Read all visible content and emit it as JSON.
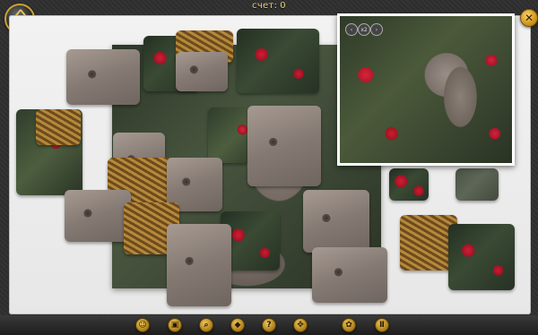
{
  "header": {
    "score_label": "счет:",
    "score_value": "0"
  },
  "preview": {
    "controls": [
      "‹",
      "x2",
      "›"
    ]
  },
  "toolbar": {
    "buttons": [
      {
        "icon": "smiley-icon",
        "glyph": "☺"
      },
      {
        "icon": "preview-image-icon",
        "glyph": "▣"
      },
      {
        "icon": "zoom-icon",
        "glyph": "⌕"
      },
      {
        "icon": "edge-pieces-icon",
        "glyph": "◆"
      },
      {
        "icon": "help-icon",
        "glyph": "?"
      },
      {
        "icon": "shuffle-icon",
        "glyph": "✥"
      },
      {
        "icon": "settings-icon",
        "glyph": "✿"
      },
      {
        "icon": "pause-icon",
        "glyph": "Ⅱ"
      }
    ]
  },
  "colors": {
    "accent_gold": "#c9a235",
    "board": "#eeeeee",
    "frame": "#2e2e2e"
  }
}
